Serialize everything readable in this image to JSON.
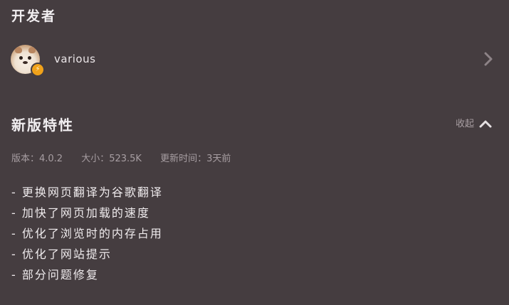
{
  "developer": {
    "section_title": "开发者",
    "name": "various",
    "badge_glyph": "⚡",
    "avatar_icon": "otter-avatar",
    "arrow_icon": "chevron-right-icon"
  },
  "features": {
    "section_title": "新版特性",
    "collapse_label": "收起",
    "collapse_icon": "chevron-up-icon",
    "meta": {
      "version": "版本：4.0.2",
      "size": "大小：523.5K",
      "updated": "更新时间：3天前"
    },
    "items": [
      "- 更换网页翻译为谷歌翻译",
      "- 加快了网页加载的速度",
      "- 优化了浏览时的内存占用",
      "- 优化了网站提示",
      "- 部分问题修复"
    ]
  },
  "colors": {
    "background": "#453d40",
    "text": "#ebe6e8",
    "muted": "#a79ea2",
    "badge": "#f0a21a"
  }
}
